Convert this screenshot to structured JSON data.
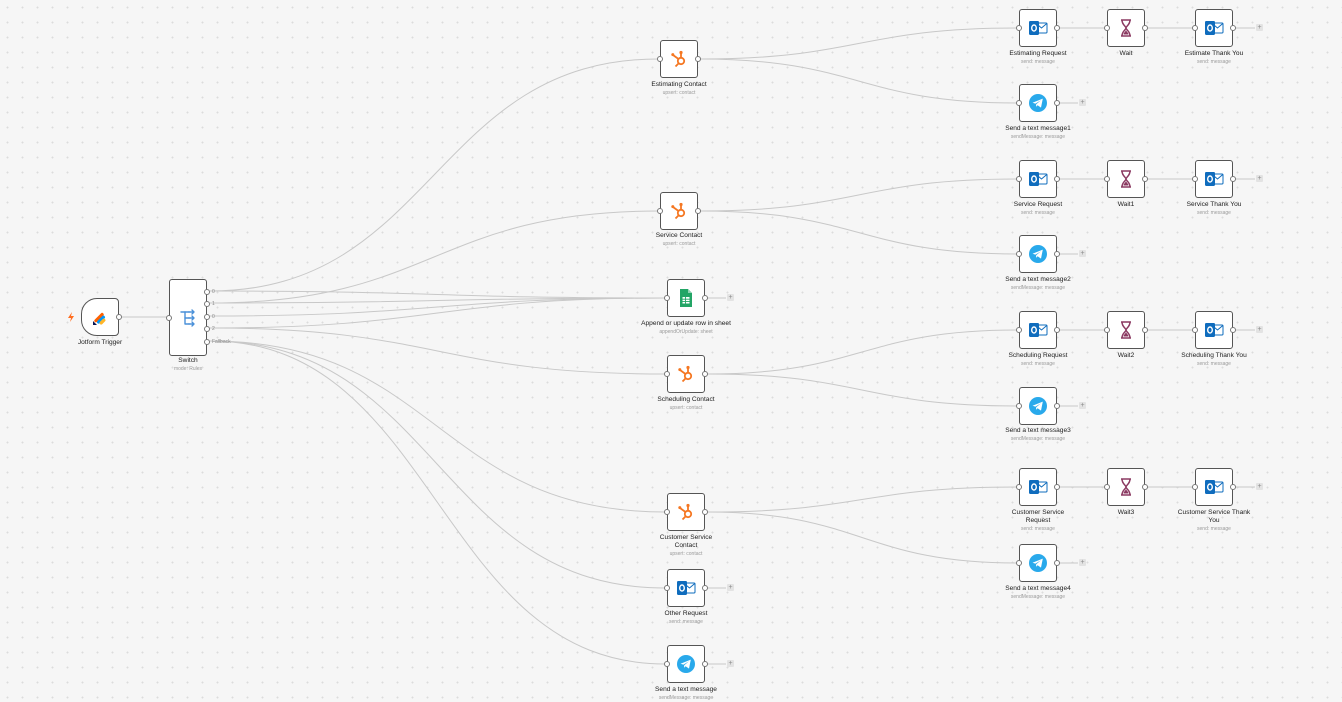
{
  "nodes": {
    "jotform": {
      "name": "Jotform Trigger",
      "sub": ""
    },
    "switch": {
      "name": "Switch",
      "sub": "mode: Rules",
      "outputs": [
        "0",
        "1",
        "0",
        "2",
        "3"
      ],
      "fallback": "Fallback"
    },
    "estimating_contact": {
      "name": "Estimating Contact",
      "sub": "upsert: contact"
    },
    "service_contact": {
      "name": "Service Contact",
      "sub": "upsert: contact"
    },
    "append_row": {
      "name": "Append or update row in sheet",
      "sub": "appendOrUpdate: sheet"
    },
    "scheduling_contact": {
      "name": "Scheduling Contact",
      "sub": "upsert: contact"
    },
    "cs_contact": {
      "name": "Customer Service Contact",
      "sub": "upsert: contact"
    },
    "other_request": {
      "name": "Other Request",
      "sub": "send: message"
    },
    "send_text": {
      "name": "Send a text message",
      "sub": "sendMessage: message"
    },
    "estimating_request": {
      "name": "Estimating Request",
      "sub": "send: message"
    },
    "wait": {
      "name": "Wait",
      "sub": ""
    },
    "estimate_thanks": {
      "name": "Estimate Thank You",
      "sub": "send: message"
    },
    "send_text1": {
      "name": "Send a text message1",
      "sub": "sendMessage: message"
    },
    "service_request": {
      "name": "Service Request",
      "sub": "send: message"
    },
    "wait1": {
      "name": "Wait1",
      "sub": ""
    },
    "service_thanks": {
      "name": "Service Thank You",
      "sub": "send: message"
    },
    "send_text2": {
      "name": "Send a text message2",
      "sub": "sendMessage: message"
    },
    "scheduling_request": {
      "name": "Scheduling Request",
      "sub": "send: message"
    },
    "wait2": {
      "name": "Wait2",
      "sub": ""
    },
    "scheduling_thanks": {
      "name": "Scheduling Thank You",
      "sub": "send: message"
    },
    "send_text3": {
      "name": "Send a text message3",
      "sub": "sendMessage: message"
    },
    "cs_request": {
      "name": "Customer Service Request",
      "sub": "send: message"
    },
    "wait3": {
      "name": "Wait3",
      "sub": ""
    },
    "cs_thanks": {
      "name": "Customer Service Thank You",
      "sub": "send: message"
    },
    "send_text4": {
      "name": "Send a text message4",
      "sub": "sendMessage: message"
    }
  },
  "icons": {
    "jotform": "jotform-icon",
    "switch": "switch-icon",
    "hubspot": "hubspot-icon",
    "sheets": "google-sheets-icon",
    "outlook": "outlook-icon",
    "telegram": "telegram-icon",
    "wait": "hourglass-icon"
  },
  "colors": {
    "hubspot": "#f57722",
    "sheets": "#23a566",
    "outlook": "#0f6cbd",
    "telegram": "#29a9eb",
    "wait": "#8b3a62",
    "trigger_bolt": "#ff6d1f",
    "edge": "#c8c8c8"
  },
  "add_button": "+"
}
